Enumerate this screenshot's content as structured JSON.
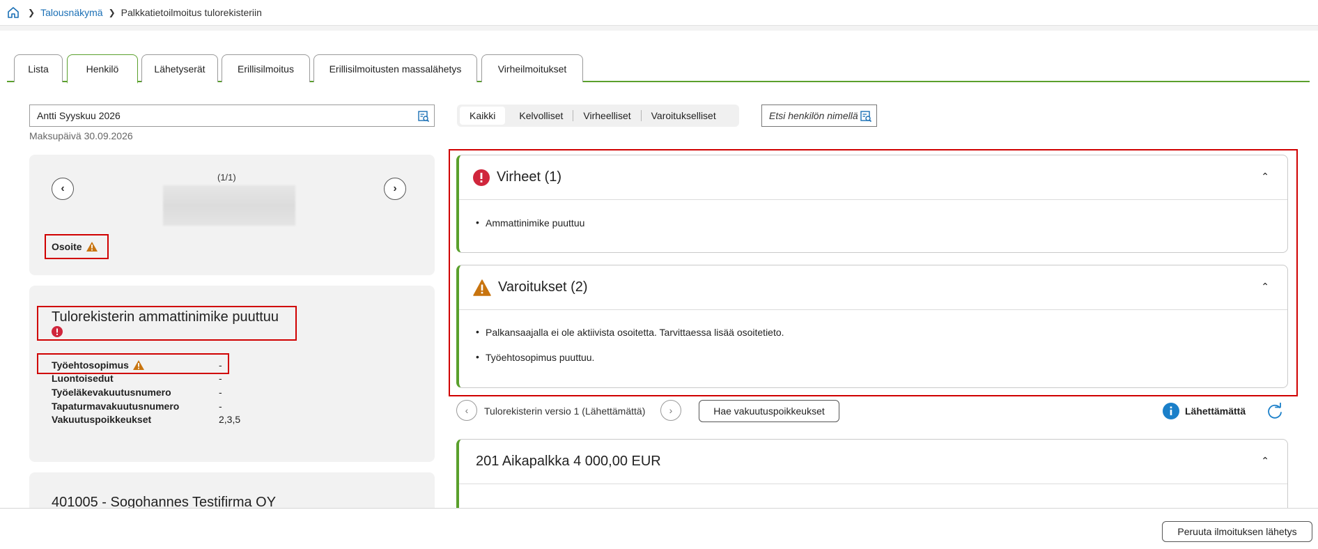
{
  "breadcrumb": {
    "link": "Talousnäkymä",
    "current": "Palkkatietoilmoitus tulorekisteriin"
  },
  "tabs": [
    {
      "label": "Lista"
    },
    {
      "label": "Henkilö"
    },
    {
      "label": "Lähetyserät"
    },
    {
      "label": "Erillisilmoitus"
    },
    {
      "label": "Erillisilmoitusten massalähetys"
    },
    {
      "label": "Virheilmoitukset"
    }
  ],
  "person": {
    "selected": "Antti Syyskuu 2026",
    "pay_date": "Maksupäivä 30.09.2026",
    "counter": "(1/1)",
    "address_label": "Osoite"
  },
  "info_card": {
    "title": "Tulorekisterin ammattinimike puuttuu",
    "rows": [
      {
        "label": "Työehtosopimus",
        "value": "-"
      },
      {
        "label": "Luontoisedut",
        "value": "-"
      },
      {
        "label": "Työeläkevakuutusnumero",
        "value": "-"
      },
      {
        "label": "Tapaturmavakuutusnumero",
        "value": "-"
      },
      {
        "label": "Vakuutuspoikkeukset",
        "value": "2,3,5"
      }
    ]
  },
  "company_card": {
    "title": "401005 - Sogohannes Testifirma OY"
  },
  "filters": {
    "items": [
      "Kaikki",
      "Kelvolliset",
      "Virheelliset",
      "Varoitukselliset"
    ],
    "search_placeholder": "Etsi henkilön nimellä"
  },
  "errors_panel": {
    "title": "Virheet (1)",
    "items": [
      "Ammattinimike puuttuu"
    ]
  },
  "warnings_panel": {
    "title": "Varoitukset (2)",
    "items": [
      "Palkansaajalla ei ole aktiivista osoitetta. Tarvittaessa lisää osoitetieto.",
      "Työehtosopimus puuttuu."
    ]
  },
  "version_bar": {
    "label": "Tulorekisterin versio 1 (Lähettämättä)",
    "fetch_button": "Hae vakuutuspoikkeukset",
    "status": "Lähettämättä"
  },
  "salary_panel": {
    "title": "201 Aikapalkka 4 000,00 EUR"
  },
  "footer": {
    "cancel_button": "Peruuta ilmoituksen lähetys"
  },
  "colors": {
    "accent_green": "#5aa02c",
    "link_blue": "#1a6fb5",
    "error_red": "#d0263c",
    "warning_orange": "#c8740f",
    "highlight_red": "#d00000"
  }
}
